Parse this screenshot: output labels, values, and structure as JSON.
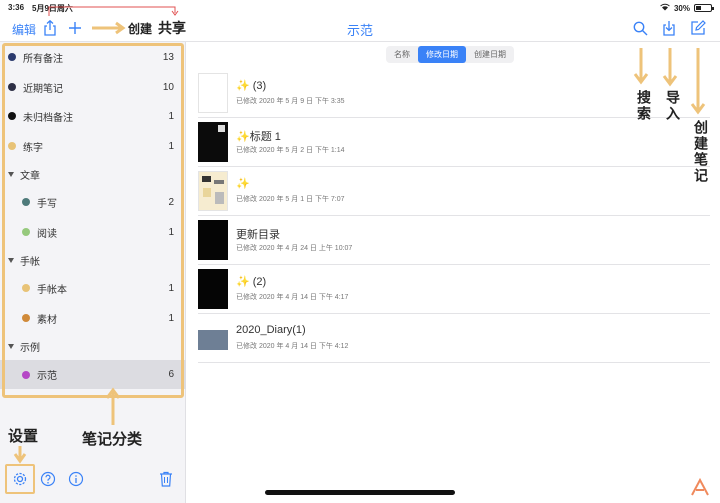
{
  "status_bar": {
    "time": "3:36",
    "date": "5月9日周六",
    "battery": "30%"
  },
  "navbar": {
    "edit_label": "编辑",
    "title": "示范"
  },
  "categories": [
    {
      "label": "所有备注",
      "count": "13",
      "color": "#2b3a6e",
      "type": "item"
    },
    {
      "label": "近期笔记",
      "count": "10",
      "color": "#2d2f45",
      "type": "item"
    },
    {
      "label": "未归档备注",
      "count": "1",
      "color": "#111111",
      "type": "item"
    },
    {
      "label": "练字",
      "count": "1",
      "color": "#e8c377",
      "type": "item"
    },
    {
      "label": "文章",
      "count": "",
      "color": "",
      "type": "group"
    },
    {
      "label": "手写",
      "count": "2",
      "color": "#4e7a7a",
      "type": "item"
    },
    {
      "label": "阅读",
      "count": "1",
      "color": "#96c97d",
      "type": "item"
    },
    {
      "label": "手帐",
      "count": "",
      "color": "",
      "type": "group"
    },
    {
      "label": "手帐本",
      "count": "1",
      "color": "#e8c377",
      "type": "item"
    },
    {
      "label": "素材",
      "count": "1",
      "color": "#d08a3a",
      "type": "item"
    },
    {
      "label": "示例",
      "count": "",
      "color": "",
      "type": "group"
    },
    {
      "label": "示范",
      "count": "6",
      "color": "#b547c6",
      "type": "item",
      "selected": true
    }
  ],
  "sort_options": [
    {
      "label": "名称",
      "active": false
    },
    {
      "label": "修改日期",
      "active": true
    },
    {
      "label": "创建日期",
      "active": false
    }
  ],
  "notes": [
    {
      "title": "✨ (3)",
      "meta": "已修改 2020 年 5 月 9 日 下午 3:35",
      "thumb": "blank"
    },
    {
      "title": "✨标题 1",
      "meta": "已修改 2020 年 5 月 2 日 下午 1:14",
      "thumb": "dark"
    },
    {
      "title": "✨",
      "meta": "已修改 2020 年 5 月 1 日 下午 7:07",
      "thumb": "collage"
    },
    {
      "title": "更新目录",
      "meta": "已修改 2020 年 4 月 24 日 上午 10:07",
      "thumb": "black"
    },
    {
      "title": "✨ (2)",
      "meta": "已修改 2020 年 4 月 14 日 下午 4:17",
      "thumb": "black"
    },
    {
      "title": "2020_Diary(1)",
      "meta": "已修改 2020 年 4 月 14 日 下午 4:12",
      "thumb": "diary"
    }
  ],
  "annotations": {
    "create": "创建",
    "share": "共享",
    "search": "搜索",
    "import": "导入",
    "create_note": "创建笔记",
    "settings": "设置",
    "categories": "笔记分类"
  },
  "colors": {
    "accent": "#3a82f7",
    "annotation": "#eec37a"
  },
  "icons": [
    "share-icon",
    "add-icon",
    "search-icon",
    "import-icon",
    "compose-icon",
    "gear-icon",
    "help-icon",
    "info-icon",
    "trash-icon"
  ]
}
